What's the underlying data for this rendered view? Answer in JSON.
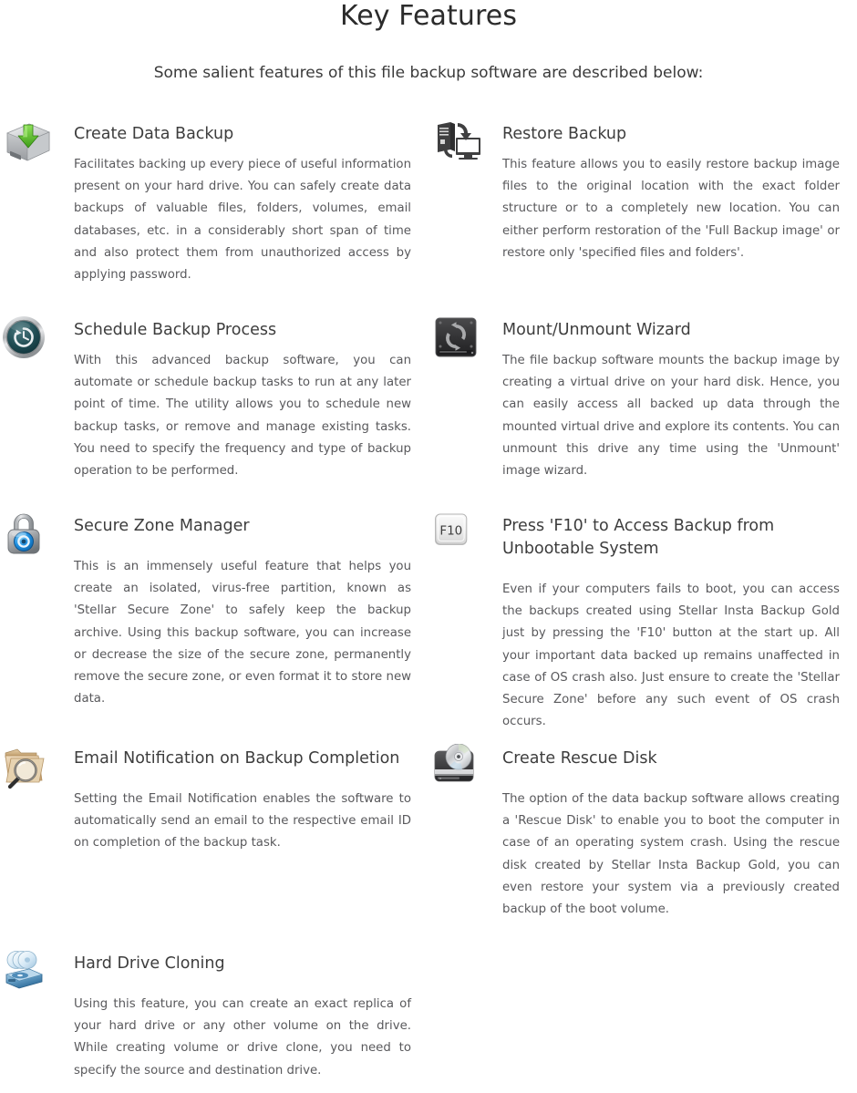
{
  "header": {
    "title": "Key Features",
    "subtitle": "Some salient features of this file backup software are described below:"
  },
  "colors": {
    "title_text": "#3d3d3d",
    "body_text": "#59595c",
    "page_background": "#ffffff",
    "accent_green": "#4caf21",
    "accent_blue": "#1f8fe0",
    "icon_dark": "#3b3b3b",
    "icon_silver": "#c9cacc",
    "icon_tan": "#d8b98c"
  },
  "features": [
    {
      "icon": "hard-drive-download-icon",
      "title": "Create Data Backup",
      "body": "Facilitates backing up every piece of useful information present on your hard drive. You can safely create data backups of valuable files, folders, volumes, email databases, etc. in a considerably short span of time and also protect them from unauthorized access by applying password."
    },
    {
      "icon": "restore-computer-monitor-icon",
      "title": "Restore Backup",
      "body": "This feature allows you to easily restore backup image files to the original location with the exact folder structure or to a completely new location. You can either perform restoration of the 'Full Backup image' or restore only 'specified files and folders'."
    },
    {
      "icon": "clock-history-icon",
      "title": "Schedule Backup Process",
      "body": "With this advanced backup software, you can automate or schedule backup tasks to run at any later point of time. The utility allows you to schedule new backup tasks, or remove and manage existing tasks. You need to specify the frequency and type of backup operation to be performed."
    },
    {
      "icon": "sync-drive-icon",
      "title": "Mount/Unmount Wizard",
      "body": "The file backup software mounts the backup image by creating a virtual drive on your hard disk. Hence, you can easily access all backed up data through the mounted virtual drive and explore its contents. You can unmount this drive any time using the 'Unmount' image wizard."
    },
    {
      "icon": "padlock-icon",
      "title": "Secure Zone Manager",
      "body": "This is an immensely useful feature that helps you create an isolated, virus-free partition, known as 'Stellar Secure Zone' to safely keep the backup archive. Using this backup software, you can increase or decrease the size of the secure zone, permanently remove the secure zone, or even format it to store new data."
    },
    {
      "icon": "f10-key-icon",
      "icon_label": "F10",
      "title": "Press 'F10' to Access Backup from Unbootable System",
      "body": "Even if your computers fails to boot, you can access the backups created using Stellar Insta Backup Gold just by pressing the 'F10' button at the start up. All your important data backed up remains unaffected in case of OS crash also. Just ensure to create the 'Stellar Secure Zone' before any such event of OS crash occurs."
    },
    {
      "icon": "folder-magnifier-icon",
      "title": "Email Notification on Backup Completion",
      "body": "Setting the Email Notification enables the software to automatically send an email to the respective email ID on completion of the backup task."
    },
    {
      "icon": "rescue-disk-cd-icon",
      "title": "Create Rescue Disk",
      "body": "The option of the data backup software allows creating a 'Rescue Disk' to enable you to boot the computer in case of an operating system crash. Using the rescue disk created by Stellar Insta Backup Gold, you can even restore your system via a previously created backup of the boot volume."
    },
    {
      "icon": "disc-stack-drive-icon",
      "title": "Hard Drive Cloning",
      "body": "Using this feature, you can create an exact replica of your hard drive or any other volume on the drive. While creating volume or drive clone, you need to specify the source and destination drive."
    }
  ]
}
